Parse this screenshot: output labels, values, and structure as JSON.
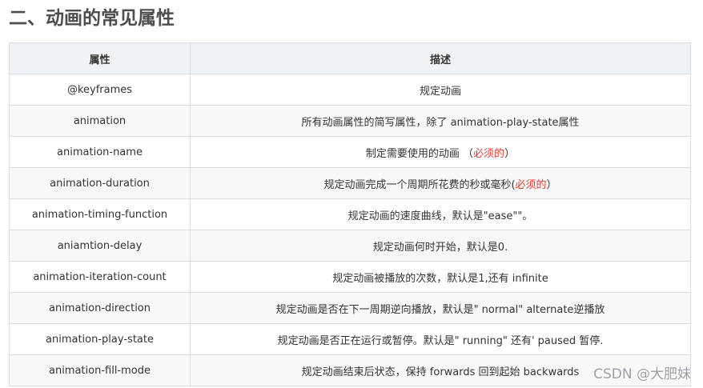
{
  "heading": "二、动画的常见属性",
  "table": {
    "headers": [
      "属性",
      "描述"
    ],
    "rows": [
      {
        "property": "@keyframes",
        "description": "规定动画",
        "required_note": ""
      },
      {
        "property": "animation",
        "description": "所有动画属性的简写属性，除了 animation-play-state属性",
        "required_note": ""
      },
      {
        "property": "animation-name",
        "description": "制定需要使用的动画 （",
        "required_note": "必须的",
        "description_suffix": "）"
      },
      {
        "property": "animation-duration",
        "description": "规定动画完成一个周期所花费的秒或毫秒(",
        "required_note": "必须的",
        "description_suffix": "）"
      },
      {
        "property": "animation-timing-function",
        "description": "规定动画的速度曲线，默认是\"ease\"\"。",
        "required_note": ""
      },
      {
        "property": "aniamtion-delay",
        "description": "规定动画何时开始，默认是0.",
        "required_note": ""
      },
      {
        "property": "animation-iteration-count",
        "description": "规定动画被播放的次数，默认是1,还有 infinite",
        "required_note": ""
      },
      {
        "property": "animation-direction",
        "description": "规定动画是否在下一周期逆向播放，默认是\" normal\" alternate逆播放",
        "required_note": ""
      },
      {
        "property": "animation-play-state",
        "description": "规定动画是否正在运行或暂停。默认是\" running\" 还有' paused 暂停.",
        "required_note": ""
      },
      {
        "property": "animation-fill-mode",
        "description": "规定动画结束后状态，保持 forwards 回到起始 backwards",
        "required_note": ""
      }
    ]
  },
  "watermark": "CSDN @大肥妹",
  "colors": {
    "heading": "#4d4d4d",
    "header_bg": "#eff3f5",
    "border": "#dddddd",
    "required": "#e33e33",
    "stripe": "#f8f8f8"
  }
}
